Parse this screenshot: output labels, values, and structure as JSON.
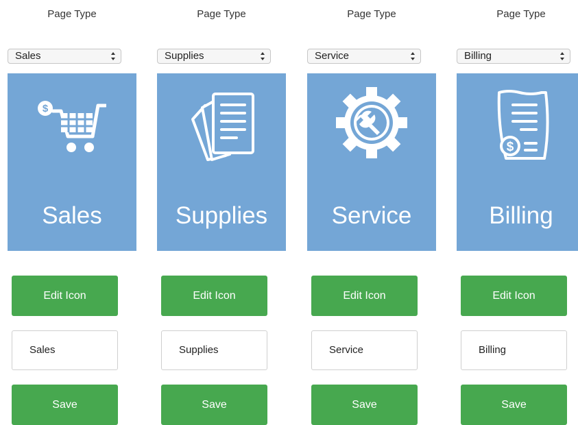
{
  "columns": [
    {
      "heading": "Page Type",
      "select_value": "Sales",
      "tile_label": "Sales",
      "icon": "shopping-cart-dollar-icon",
      "edit_button": "Edit Icon",
      "name_value": "Sales",
      "save_button": "Save"
    },
    {
      "heading": "Page Type",
      "select_value": "Supplies",
      "tile_label": "Supplies",
      "icon": "documents-icon",
      "edit_button": "Edit Icon",
      "name_value": "Supplies",
      "save_button": "Save"
    },
    {
      "heading": "Page Type",
      "select_value": "Service",
      "tile_label": "Service",
      "icon": "gear-wrench-icon",
      "edit_button": "Edit Icon",
      "name_value": "Service",
      "save_button": "Save"
    },
    {
      "heading": "Page Type",
      "select_value": "Billing",
      "tile_label": "Billing",
      "icon": "invoice-dollar-icon",
      "edit_button": "Edit Icon",
      "name_value": "Billing",
      "save_button": "Save"
    }
  ],
  "colors": {
    "tile_background": "#74a6d6",
    "button_green": "#47a84f",
    "tile_text": "#ffffff"
  }
}
